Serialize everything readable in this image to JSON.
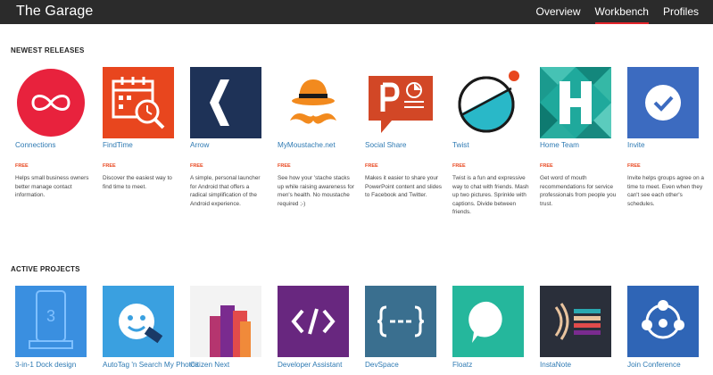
{
  "header": {
    "brand": "The Garage",
    "nav": [
      {
        "label": "Overview",
        "active": false
      },
      {
        "label": "Workbench",
        "active": true
      },
      {
        "label": "Profiles",
        "active": false
      }
    ]
  },
  "newest": {
    "title": "NEWEST RELEASES",
    "apps": [
      {
        "name": "Connections",
        "price": "FREE",
        "desc": "Helps small business owners better manage contact information.",
        "icon": "infinity-icon",
        "color": "#e8223d"
      },
      {
        "name": "FindTime",
        "price": "FREE",
        "desc": "Discover the easiest way to find time to meet.",
        "icon": "calendar-search-icon",
        "color": "#e8461e"
      },
      {
        "name": "Arrow",
        "price": "FREE",
        "desc": "A simple, personal launcher for Android that offers a radical simplification of the Android experience.",
        "icon": "chevron-left-icon",
        "color": "#1e3257"
      },
      {
        "name": "MyMoustache.net",
        "price": "FREE",
        "desc": "See how your 'stache stacks up while raising awareness for men's health. No moustache required ;-)",
        "icon": "moustache-hat-icon",
        "color": "#f28a1e"
      },
      {
        "name": "Social Share",
        "price": "FREE",
        "desc": "Makes it easier to share your PowerPoint content and slides to Facebook and Twitter.",
        "icon": "powerpoint-icon",
        "color": "#d24726"
      },
      {
        "name": "Twist",
        "price": "FREE",
        "desc": "Twist is a fun and expressive way to chat with friends. Mash up two pictures. Sprinkle with captions. Divide between friends.",
        "icon": "twist-icon",
        "color": "#29b8c8"
      },
      {
        "name": "Home Team",
        "price": "FREE",
        "desc": "Get word of mouth recommendations for service professionals from people you trust.",
        "icon": "letter-h-icon",
        "color": "#1fa99c"
      },
      {
        "name": "Invite",
        "price": "FREE",
        "desc": "Invite helps groups agree on a time to meet. Even when they can't see each other's schedules.",
        "icon": "checkmark-icon",
        "color": "#3c6bc0"
      }
    ]
  },
  "active": {
    "title": "ACTIVE PROJECTS",
    "apps": [
      {
        "name": "3-in-1 Dock design",
        "icon": "phone-dock-icon",
        "color": "#3a8fe0"
      },
      {
        "name": "AutoTag 'n Search My Photos",
        "icon": "face-tag-icon",
        "color": "#3aa0e0"
      },
      {
        "name": "Citizen Next",
        "icon": "building-bars-icon",
        "color": "#f3f3f3"
      },
      {
        "name": "Developer Assistant",
        "icon": "code-brackets-icon",
        "color": "#68277f"
      },
      {
        "name": "DevSpace",
        "icon": "curly-braces-icon",
        "color": "#3a6f8f"
      },
      {
        "name": "Floatz",
        "icon": "speech-bubble-icon",
        "color": "#25b79c"
      },
      {
        "name": "InstaNote",
        "icon": "sound-lines-icon",
        "color": "#2a2f3a"
      },
      {
        "name": "Join Conference",
        "icon": "people-circle-icon",
        "color": "#2f65b6"
      }
    ]
  }
}
